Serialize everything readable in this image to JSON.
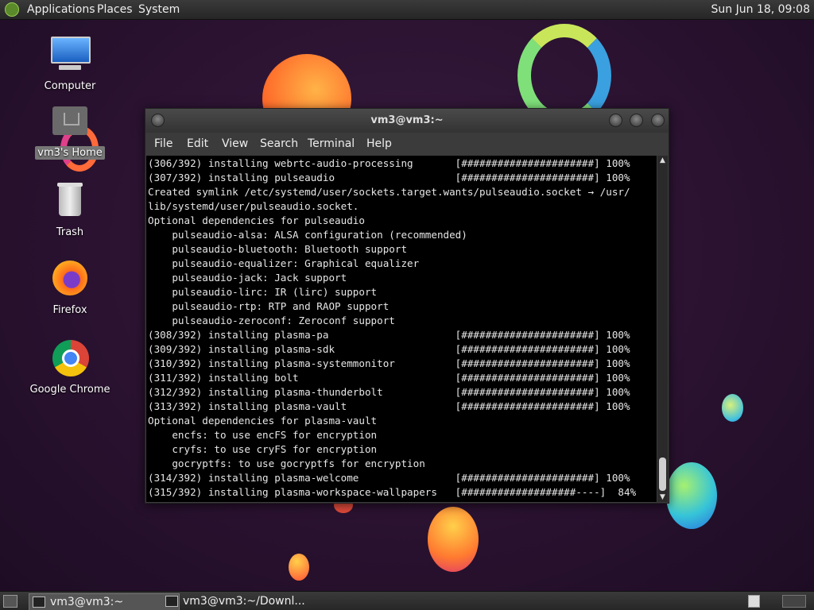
{
  "top_panel": {
    "menus": [
      "Applications",
      "Places",
      "System"
    ],
    "clock": "Sun Jun 18, 09:08"
  },
  "desktop": {
    "icons": [
      {
        "label": "Computer",
        "icon": "computer-icon"
      },
      {
        "label": "vm3's Home",
        "icon": "home-folder-icon"
      },
      {
        "label": "Trash",
        "icon": "trash-icon"
      },
      {
        "label": "Firefox",
        "icon": "firefox-icon"
      },
      {
        "label": "Google Chrome",
        "icon": "chrome-icon"
      }
    ]
  },
  "terminal": {
    "title": "vm3@vm3:~",
    "menu": [
      "File",
      "Edit",
      "View",
      "Search",
      "Terminal",
      "Help"
    ],
    "lines": [
      "(306/392) installing webrtc-audio-processing       [######################] 100%",
      "(307/392) installing pulseaudio                    [######################] 100%",
      "Created symlink /etc/systemd/user/sockets.target.wants/pulseaudio.socket → /usr/",
      "lib/systemd/user/pulseaudio.socket.",
      "Optional dependencies for pulseaudio",
      "    pulseaudio-alsa: ALSA configuration (recommended)",
      "    pulseaudio-bluetooth: Bluetooth support",
      "    pulseaudio-equalizer: Graphical equalizer",
      "    pulseaudio-jack: Jack support",
      "    pulseaudio-lirc: IR (lirc) support",
      "    pulseaudio-rtp: RTP and RAOP support",
      "    pulseaudio-zeroconf: Zeroconf support",
      "(308/392) installing plasma-pa                     [######################] 100%",
      "(309/392) installing plasma-sdk                    [######################] 100%",
      "(310/392) installing plasma-systemmonitor          [######################] 100%",
      "(311/392) installing bolt                          [######################] 100%",
      "(312/392) installing plasma-thunderbolt            [######################] 100%",
      "(313/392) installing plasma-vault                  [######################] 100%",
      "Optional dependencies for plasma-vault",
      "    encfs: to use encFS for encryption",
      "    cryfs: to use cryFS for encryption",
      "    gocryptfs: to use gocryptfs for encryption",
      "(314/392) installing plasma-welcome                [######################] 100%",
      "(315/392) installing plasma-workspace-wallpapers   [###################----]  84%"
    ]
  },
  "taskbar": {
    "tasks": [
      "vm3@vm3:~",
      "vm3@vm3:~/Downl..."
    ]
  }
}
